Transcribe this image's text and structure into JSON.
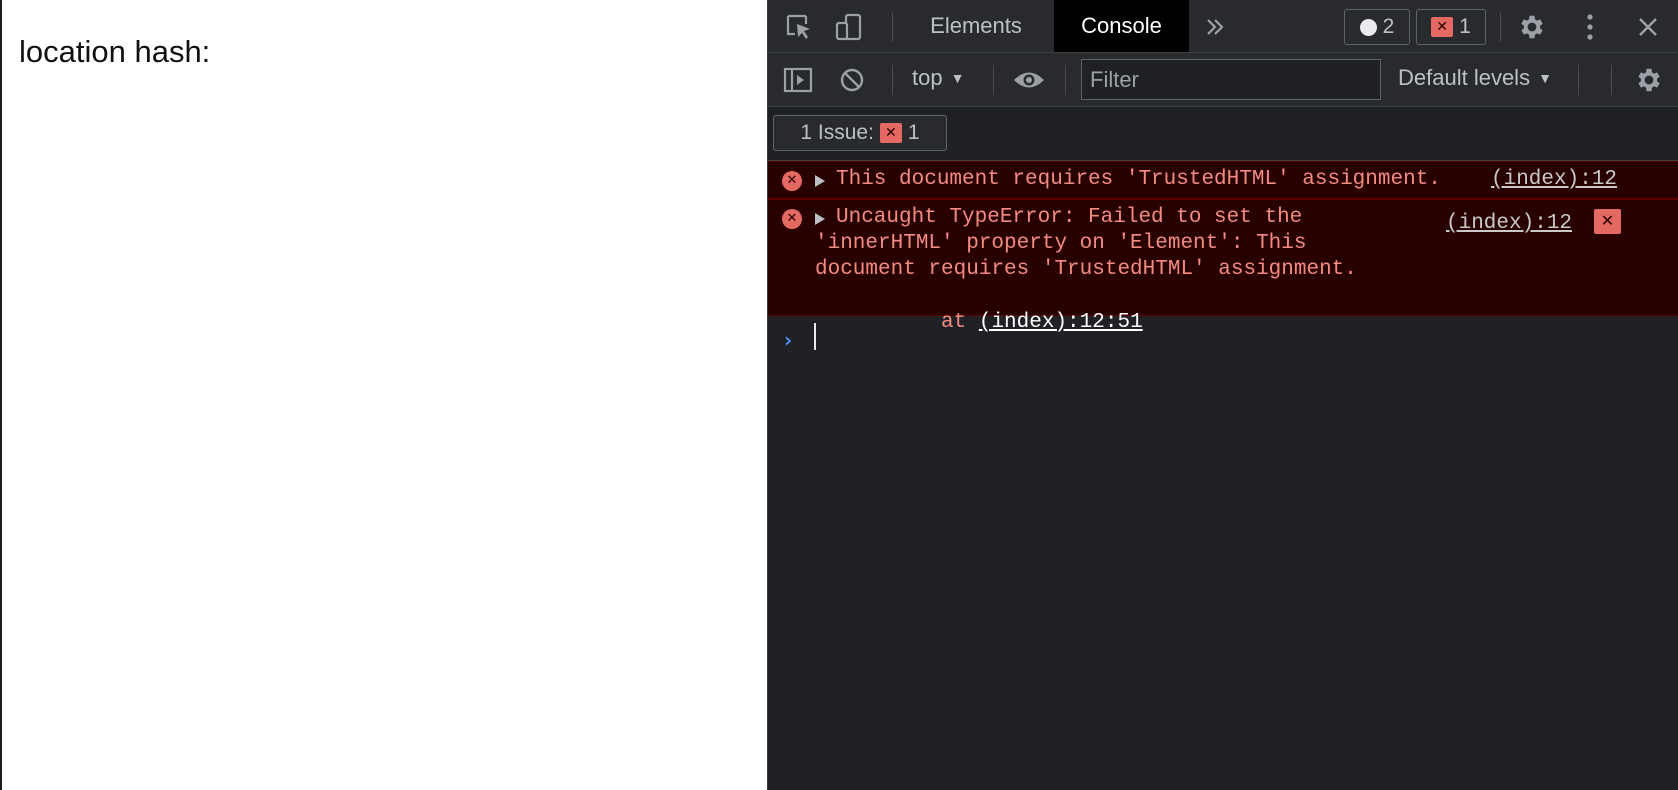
{
  "page": {
    "hash_label": "location hash:"
  },
  "devtools": {
    "toolbar": {
      "inspect_icon": "inspect-element-icon",
      "device_icon": "device-toolbar-icon",
      "tabs": [
        {
          "label": "Elements",
          "active": false
        },
        {
          "label": "Console",
          "active": true
        }
      ],
      "more_tabs_icon": "chevron-double-right-icon",
      "info_count": "2",
      "error_count": "1",
      "settings_icon": "gear-icon",
      "menu_icon": "kebab-menu-icon",
      "close_icon": "close-icon"
    },
    "console_toolbar": {
      "sidebar_icon": "show-sidebar-icon",
      "clear_icon": "clear-console-icon",
      "context": "top",
      "eye_icon": "eye-icon",
      "filter_placeholder": "Filter",
      "levels": "Default levels",
      "settings_icon": "gear-icon"
    },
    "issues": {
      "label": "1 Issue:",
      "count": "1"
    },
    "messages": [
      {
        "level": "error",
        "text": "This document requires 'TrustedHTML' assignment.",
        "source": "(index):12"
      },
      {
        "level": "error",
        "lines": [
          "Uncaught TypeError: Failed to set the",
          "'innerHTML' property on 'Element': This",
          "document requires 'TrustedHTML' assignment.",
          "    at "
        ],
        "at_link": "(index):12:51",
        "source": "(index):12"
      }
    ],
    "colors": {
      "panel_bg": "#202124",
      "toolbar_bg": "#292a2d",
      "error_bg": "#290000",
      "error_text": "#f28b82",
      "error_badge": "#e46962",
      "prompt": "#4d8efc"
    }
  }
}
